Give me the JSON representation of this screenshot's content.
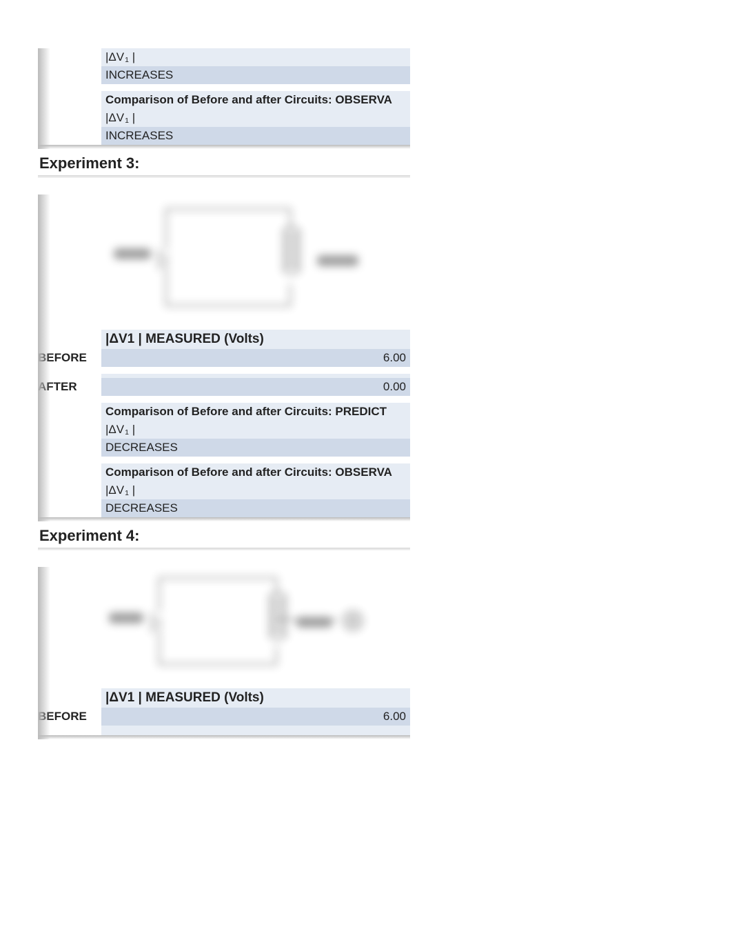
{
  "top_block": {
    "dv_header": "|ΔV1 |",
    "predict_value": "INCREASES",
    "observa_title": "Comparison of Before and after Circuits:  OBSERVA",
    "dv_header2": "|ΔV1 |",
    "observa_value": "INCREASES"
  },
  "exp3": {
    "title": "Experiment 3:",
    "measured_header": "|ΔV1 | MEASURED (Volts)",
    "before_label": "BEFORE",
    "before_value": "6.00",
    "after_label": "AFTER",
    "after_value": "0.00",
    "predict_title": "Comparison of Before and after Circuits:  PREDICT",
    "predict_dv": "|ΔV1 |",
    "predict_value": "DECREASES",
    "observa_title": "Comparison of Before and after Circuits:  OBSERVA",
    "observa_dv": "|ΔV1 |",
    "observa_value": "DECREASES"
  },
  "exp4": {
    "title": "Experiment 4:",
    "measured_header": "|ΔV1 | MEASURED (Volts)",
    "before_label": "BEFORE",
    "before_value": "6.00"
  }
}
